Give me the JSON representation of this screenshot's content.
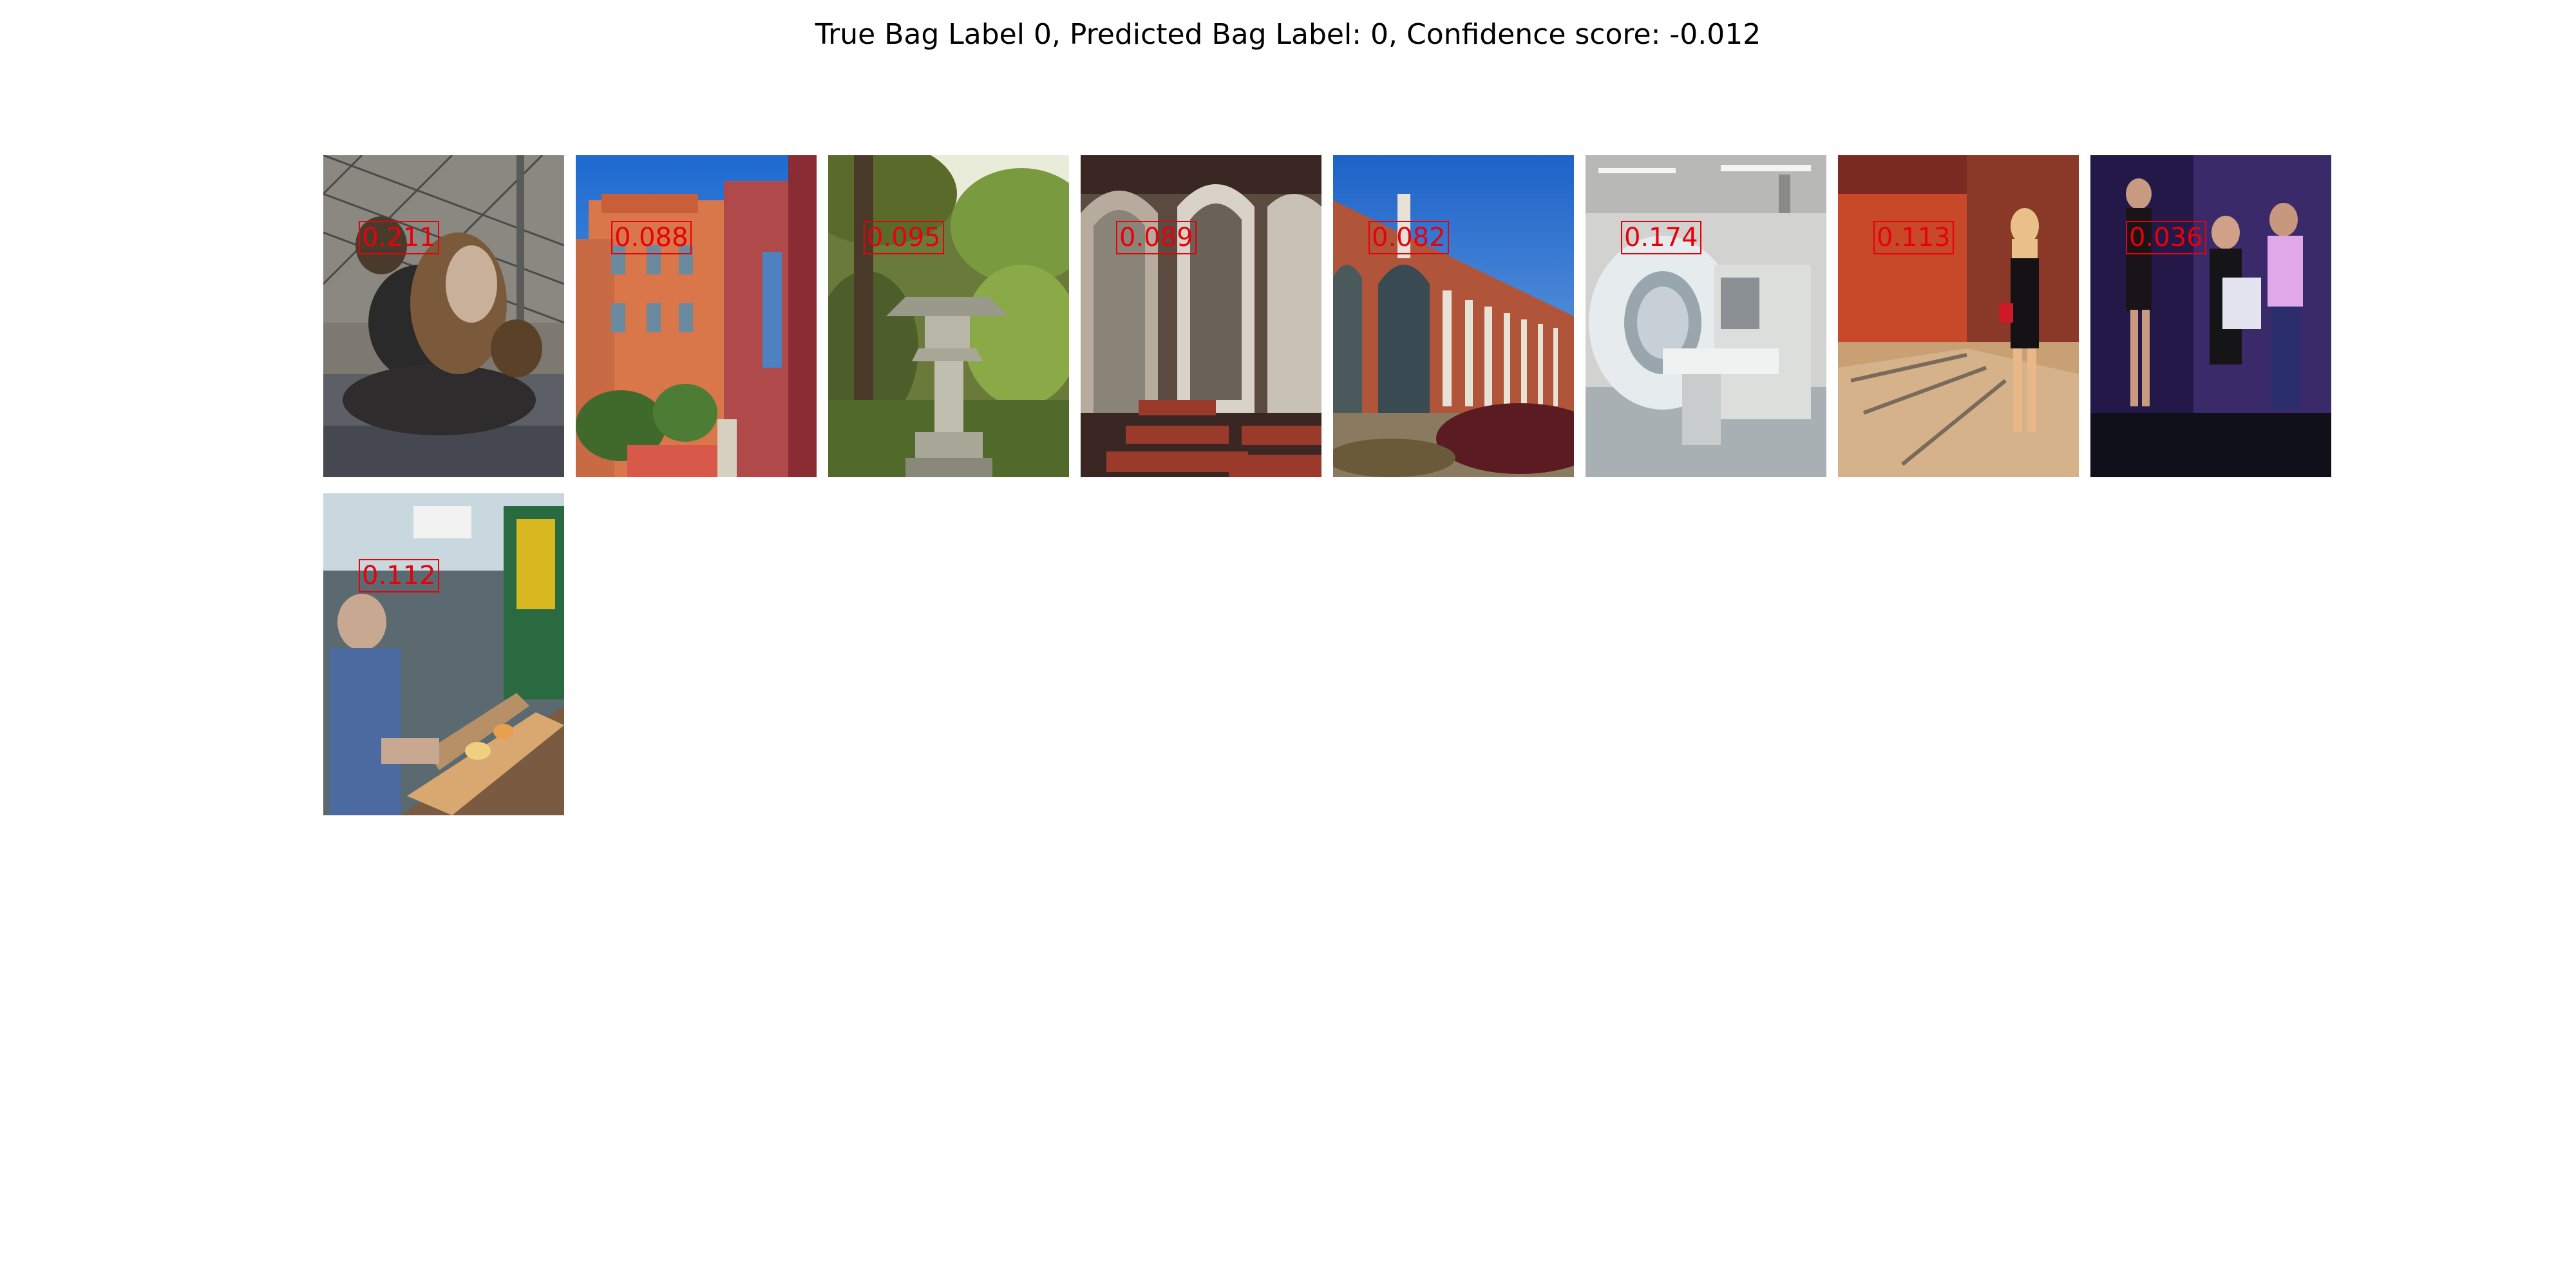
{
  "figure": {
    "title": "True Bag Label 0, Predicted Bag Label: 0, Confidence score: -0.012"
  },
  "instances": [
    {
      "score": "0.211",
      "scene": "woman-hugging-dog-photo"
    },
    {
      "score": "0.088",
      "scene": "colorful-street-buildings-photo"
    },
    {
      "score": "0.095",
      "scene": "stone-lantern-garden-photo"
    },
    {
      "score": "0.089",
      "scene": "church-interior-photo"
    },
    {
      "score": "0.082",
      "scene": "brick-arcade-building-photo"
    },
    {
      "score": "0.174",
      "scene": "ct-scanner-room-photo"
    },
    {
      "score": "0.113",
      "scene": "woman-bowling-alley-photo"
    },
    {
      "score": "0.036",
      "scene": "people-on-stage-photo"
    },
    {
      "score": "0.112",
      "scene": "pinball-arcade-photo"
    }
  ],
  "colors": {
    "score_text": "#e8000b",
    "background": "#ffffff"
  }
}
